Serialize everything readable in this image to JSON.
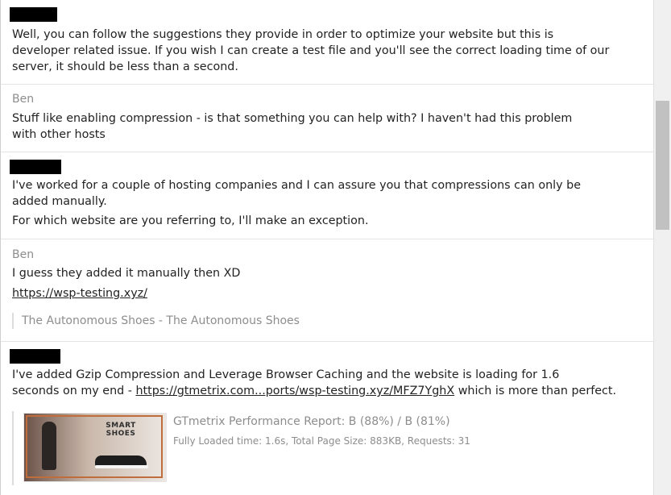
{
  "messages": [
    {
      "author": "",
      "lines": [
        "Well, you can follow the suggestions they provide in order to optimize your website but this is",
        "developer related issue. If you wish I can create a test file and you'll see the correct loading time of our",
        "server, it should be less than a second."
      ]
    },
    {
      "author": "Ben",
      "lines": [
        "Stuff like enabling compression - is that something you can help with? I haven't had this problem",
        "with other hosts"
      ]
    },
    {
      "author": "",
      "lines": [
        "I've worked for a couple of hosting companies and I can assure you that compressions can only be",
        "added manually.",
        "For which website are you referring to, I'll make an exception."
      ]
    },
    {
      "author": "Ben",
      "lines": [
        "I guess they added it manually then XD"
      ],
      "link": "https://wsp-testing.xyz/",
      "link_preview": "The Autonomous Shoes - The Autonomous Shoes"
    },
    {
      "author": "",
      "line1": "I've added Gzip Compression and Leverage Browser Caching and the website is loading for 1.6",
      "line2_prefix": "seconds on my end - ",
      "line2_link": "https://gtmetrix.com...ports/wsp-testing.xyz/MFZ7YghX",
      "line2_suffix": " which is more than perfect.",
      "embed": {
        "thumb_text": "SMART SHOES",
        "title": "GTmetrix Performance Report: B (88%) / B (81%)",
        "description": "Fully Loaded time: 1.6s, Total Page Size: 883KB, Requests: 31"
      }
    }
  ]
}
